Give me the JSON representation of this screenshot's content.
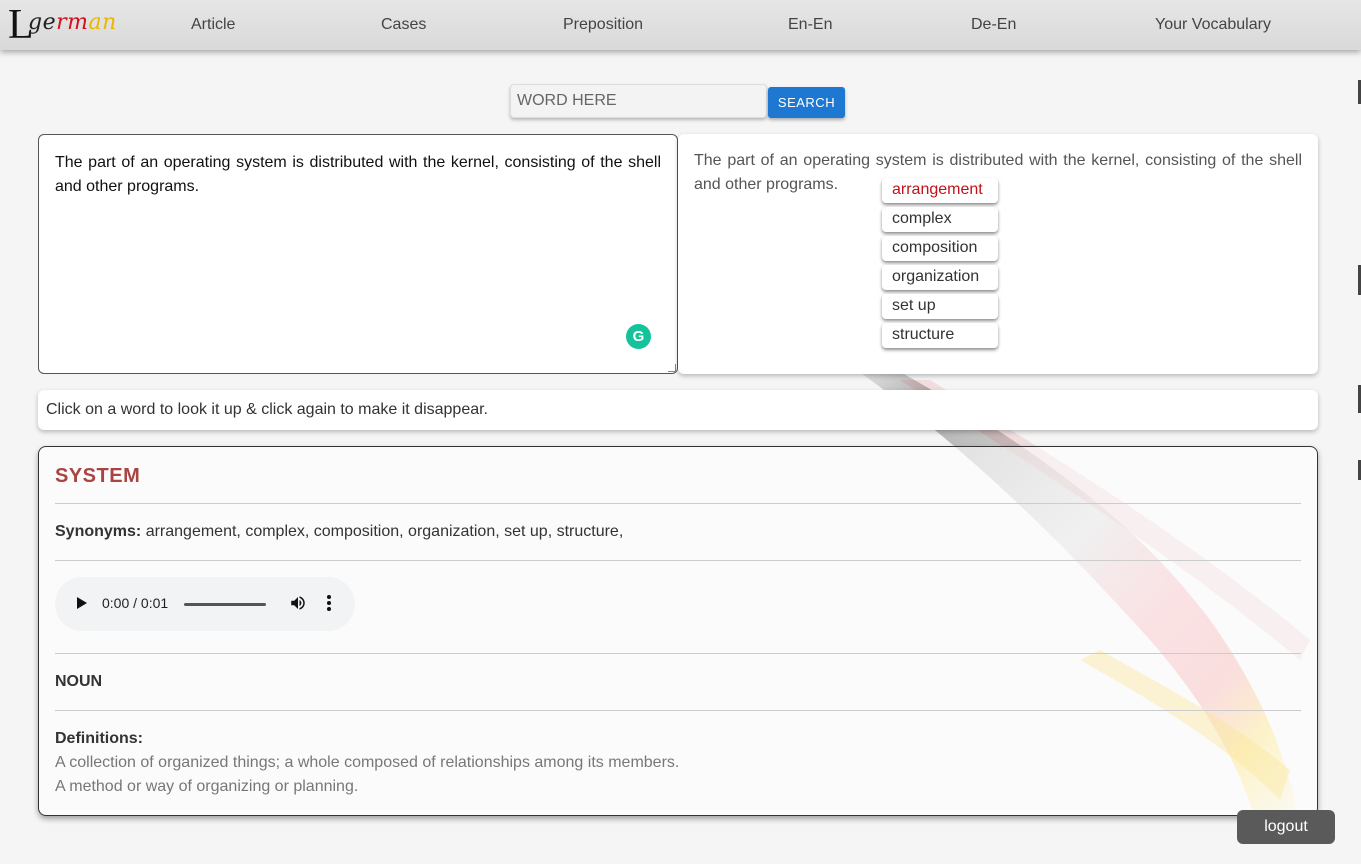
{
  "logo": {
    "letter": "L",
    "parts": [
      "ge",
      "rm",
      "an"
    ]
  },
  "nav": {
    "items": [
      "Article",
      "Cases",
      "Preposition",
      "En-En",
      "De-En",
      "Your Vocabulary"
    ]
  },
  "search": {
    "placeholder": "WORD HERE",
    "button_label": "SEARCH"
  },
  "input_panel": {
    "text": "The part of an operating system is distributed with the kernel, consisting of the shell and other programs.",
    "grammarly_icon": "G"
  },
  "lookup_panel": {
    "text": "The part of an operating system is distributed with the kernel, consisting of the shell and other programs."
  },
  "synonym_popup": {
    "items": [
      "arrangement",
      "complex",
      "composition",
      "organization",
      "set up",
      "structure"
    ],
    "active_index": 0,
    "active_color": "#c0121a"
  },
  "hint": "Click on a word to look it up & click again to make it disappear.",
  "definition": {
    "word": "SYSTEM",
    "synonyms_label": "Synonyms:",
    "synonyms_text": "arrangement, complex, composition, organization, set up, structure,",
    "audio": {
      "time": "0:00 / 0:01"
    },
    "part_of_speech": "NOUN",
    "definitions_label": "Definitions:",
    "definitions": [
      "A collection of organized things; a whole composed of relationships among its members.",
      "A method or way of organizing or planning."
    ]
  },
  "logout_label": "logout",
  "colors": {
    "accent": "#1e78d2",
    "title": "#a94442",
    "flag_black": "#222222",
    "flag_red": "#d0121a",
    "flag_gold": "#e8b800"
  }
}
